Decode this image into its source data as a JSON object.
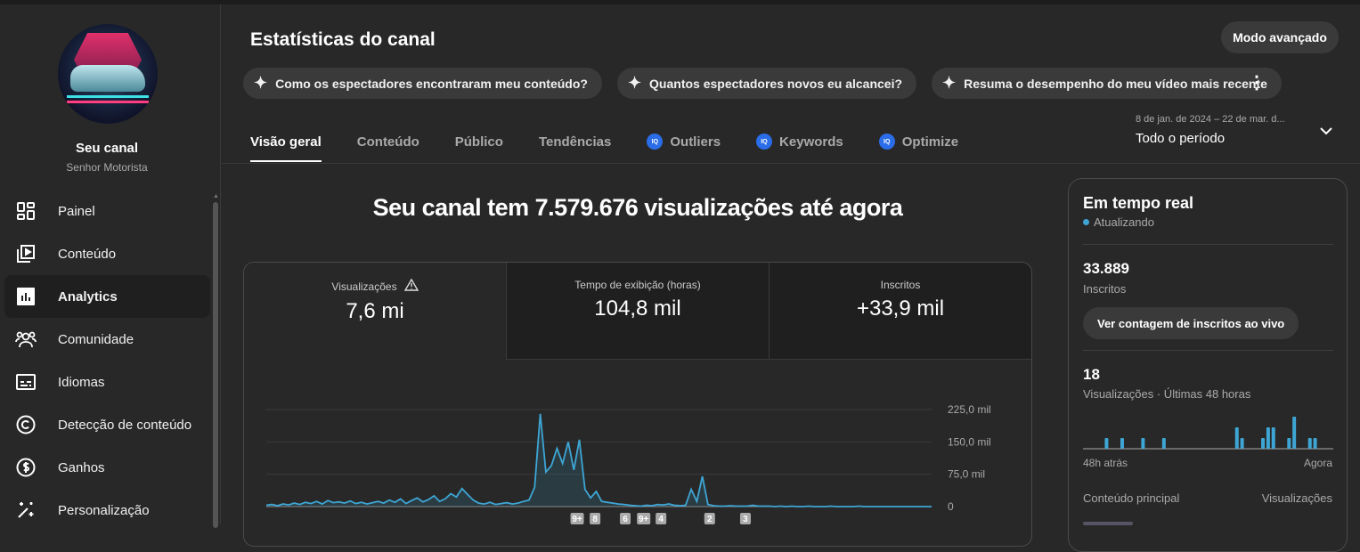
{
  "sidebar": {
    "channel_title": "Seu canal",
    "channel_name": "Senhor Motorista",
    "items": [
      {
        "label": "Painel",
        "icon": "dashboard-icon"
      },
      {
        "label": "Conteúdo",
        "icon": "content-icon"
      },
      {
        "label": "Analytics",
        "icon": "analytics-icon",
        "active": true
      },
      {
        "label": "Comunidade",
        "icon": "community-icon"
      },
      {
        "label": "Idiomas",
        "icon": "subtitles-icon"
      },
      {
        "label": "Detecção de conteúdo",
        "icon": "copyright-icon"
      },
      {
        "label": "Ganhos",
        "icon": "dollar-icon"
      },
      {
        "label": "Personalização",
        "icon": "magic-wand-icon"
      }
    ]
  },
  "header": {
    "title": "Estatísticas do canal",
    "advanced_button": "Modo avançado",
    "chips": [
      "Como os espectadores encontraram meu conteúdo?",
      "Quantos espectadores novos eu alcancei?",
      "Resuma o desempenho do meu vídeo mais recente"
    ],
    "tabs": [
      {
        "label": "Visão geral",
        "active": true
      },
      {
        "label": "Conteúdo"
      },
      {
        "label": "Público"
      },
      {
        "label": "Tendências"
      },
      {
        "label": "Outliers",
        "badge": "vidIQ"
      },
      {
        "label": "Keywords",
        "badge": "vidIQ"
      },
      {
        "label": "Optimize",
        "badge": "vidIQ"
      }
    ],
    "date_range": "8 de jan. de 2024 – 22 de mar. d...",
    "period": "Todo o período"
  },
  "main": {
    "headline": "Seu canal tem 7.579.676 visualizações até agora",
    "metrics": [
      {
        "label": "Visualizações",
        "value": "7,6 mi",
        "warning": true
      },
      {
        "label": "Tempo de exibição (horas)",
        "value": "104,8 mil"
      },
      {
        "label": "Inscritos",
        "value": "+33,9 mil"
      }
    ]
  },
  "chart_data": {
    "type": "area",
    "series": [
      {
        "name": "Visualizações",
        "values": [
          3,
          5,
          2,
          6,
          4,
          8,
          5,
          10,
          7,
          12,
          6,
          14,
          9,
          11,
          8,
          13,
          7,
          10,
          6,
          9,
          12,
          8,
          15,
          10,
          18,
          7,
          14,
          20,
          11,
          16,
          25,
          12,
          18,
          30,
          22,
          42,
          28,
          15,
          8,
          6,
          10,
          5,
          7,
          9,
          6,
          8,
          12,
          15,
          45,
          215,
          80,
          95,
          135,
          100,
          150,
          85,
          155,
          40,
          20,
          35,
          12,
          10,
          8,
          6,
          5,
          3,
          2,
          1,
          3,
          2,
          5,
          4,
          6,
          3,
          2,
          3,
          40,
          12,
          70,
          5,
          2,
          1,
          1,
          2,
          1,
          1,
          1,
          3,
          1,
          1,
          1,
          0,
          1,
          0,
          1,
          0,
          0,
          1,
          0,
          0,
          0,
          1,
          0,
          0,
          0,
          0,
          1,
          0,
          0,
          0,
          0,
          0,
          0,
          0,
          0,
          0,
          0,
          0,
          0,
          0
        ]
      }
    ],
    "unit": "mil",
    "ylim": [
      0,
      225
    ],
    "yticks": [
      0,
      75,
      150,
      225
    ],
    "ytick_labels": [
      "0",
      "75,0 mil",
      "150,0 mil",
      "225,0 mil"
    ],
    "markers": [
      {
        "label": "9+",
        "at": 55.6
      },
      {
        "label": "8",
        "at": 58.8
      },
      {
        "label": "6",
        "at": 64.2
      },
      {
        "label": "9+",
        "at": 67.5
      },
      {
        "label": "4",
        "at": 70.6
      },
      {
        "label": "2",
        "at": 79.3
      },
      {
        "label": "3",
        "at": 85.7
      }
    ],
    "color": "#3ea6d5"
  },
  "realtime": {
    "title": "Em tempo real",
    "status": "Atualizando",
    "subscribers": "33.889",
    "subscribers_label": "Inscritos",
    "live_button": "Ver contagem de inscritos ao vivo",
    "views": "18",
    "views_label": "Visualizações · Últimas 48 horas",
    "axis_start": "48h atrás",
    "axis_end": "Agora",
    "hourly_views": [
      0,
      0,
      0,
      0,
      1,
      0,
      0,
      1,
      0,
      0,
      0,
      1,
      0,
      0,
      0,
      1,
      0,
      0,
      0,
      0,
      0,
      0,
      0,
      0,
      0,
      0,
      0,
      0,
      0,
      2,
      1,
      0,
      0,
      0,
      1,
      2,
      2,
      0,
      0,
      1,
      3,
      0,
      0,
      1,
      1,
      0,
      0,
      0
    ],
    "top_content_label": "Conteúdo principal",
    "views_col_label": "Visualizações"
  }
}
